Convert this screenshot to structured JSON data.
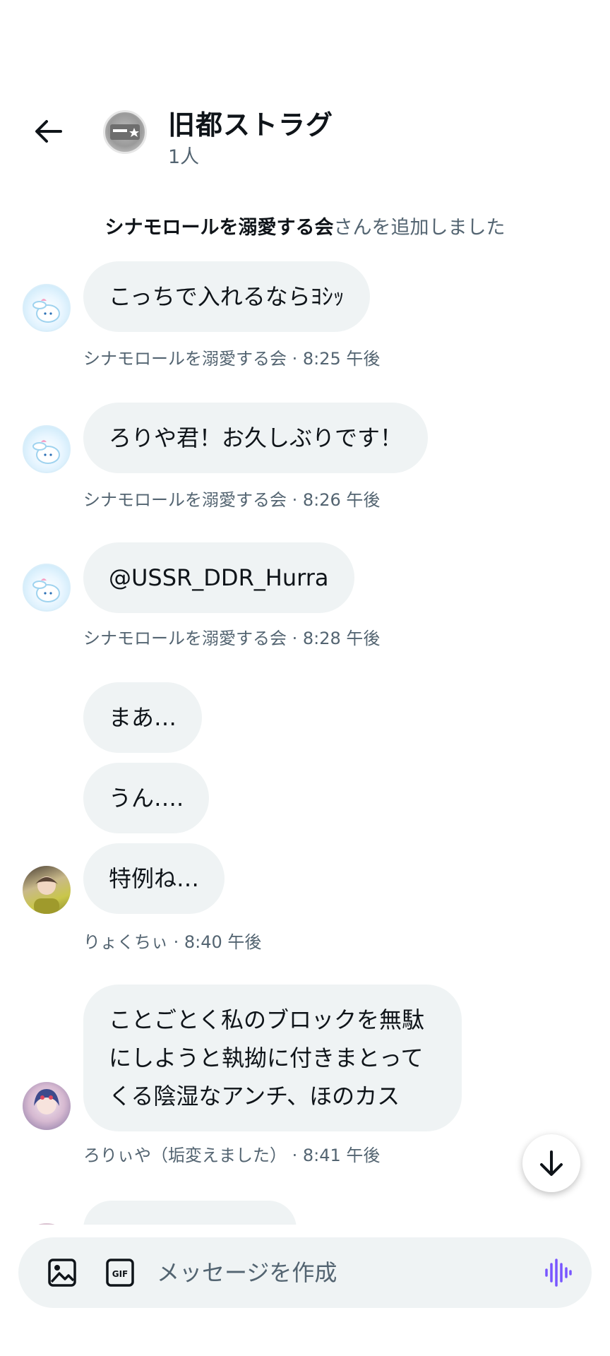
{
  "header": {
    "back_label": "←",
    "title": "旧都ストラグ",
    "member_count": "1人"
  },
  "system_notice": {
    "name": "シナモロールを溺愛する会",
    "suffix": "さんを追加しました"
  },
  "messages": [
    {
      "text": "こっちで入れるならﾖｼｯ",
      "meta": "シナモロールを溺愛する会 · 8:25 午後"
    },
    {
      "text": "ろりや君！お久しぶりです！",
      "meta": "シナモロールを溺愛する会 · 8:26 午後"
    },
    {
      "text": "@USSR_DDR_Hurra",
      "meta": "シナモロールを溺愛する会 · 8:28 午後"
    },
    {
      "text": "まあ…"
    },
    {
      "text": "うん…."
    },
    {
      "text": "特例ね…",
      "meta": "りょくちぃ · 8:40 午後"
    },
    {
      "text": "ことごとく私のブロックを無駄にしようと執拗に付きまとってくる陰湿なアンチ、ほのカス",
      "meta": "ろりぃや（垢変えました） · 8:41 午後"
    }
  ],
  "composer": {
    "placeholder": "メッセージを作成"
  },
  "colors": {
    "bubble": "#eff3f4",
    "meta_text": "#536471",
    "accent_voice": "#7856ff"
  },
  "icons": {
    "back": "arrow-left-icon",
    "image": "image-icon",
    "gif": "gif-icon",
    "voice": "voice-wave-icon",
    "scroll_down": "arrow-down-icon"
  }
}
